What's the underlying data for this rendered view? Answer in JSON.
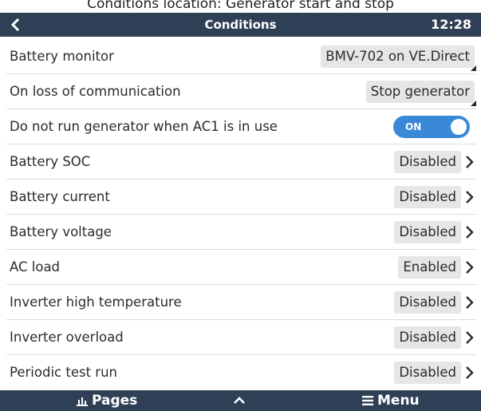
{
  "caption": "Conditions location: Generator start and stop",
  "header": {
    "title": "Conditions",
    "time": "12:28"
  },
  "rows": [
    {
      "label": "Battery monitor",
      "value": "BMV-702 on VE.Direct"
    },
    {
      "label": "On loss of communication",
      "value": "Stop generator"
    },
    {
      "label": "Do not run generator when AC1 is in use",
      "value": "ON"
    },
    {
      "label": "Battery SOC",
      "value": "Disabled"
    },
    {
      "label": "Battery current",
      "value": "Disabled"
    },
    {
      "label": "Battery voltage",
      "value": "Disabled"
    },
    {
      "label": "AC load",
      "value": "Enabled"
    },
    {
      "label": "Inverter high temperature",
      "value": "Disabled"
    },
    {
      "label": "Inverter overload",
      "value": "Disabled"
    },
    {
      "label": "Periodic test run",
      "value": "Disabled"
    }
  ],
  "footer": {
    "pages_label": "Pages",
    "menu_label": "Menu"
  },
  "icons": {
    "back": "chevron-left-icon",
    "next": "chevron-right-icon",
    "pages": "chart-bars-icon",
    "up": "chevron-up-icon",
    "menu": "hamburger-icon"
  },
  "colors": {
    "bar": "#2f3f55",
    "toggle_on": "#3a88d8",
    "value_bg": "#e6e6e6"
  }
}
